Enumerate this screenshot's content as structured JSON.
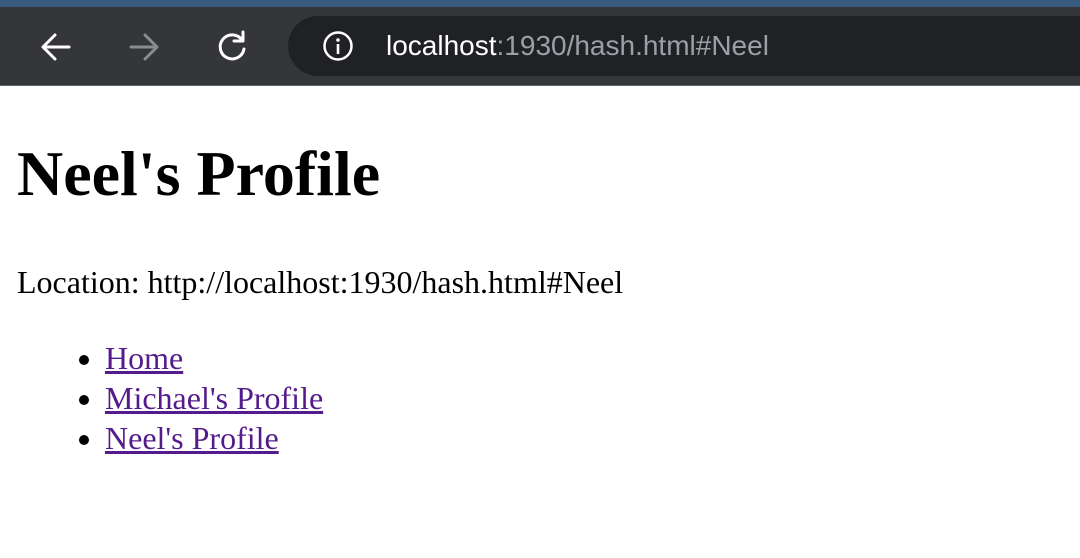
{
  "browser": {
    "url_host": "localhost",
    "url_rest": ":1930/hash.html#Neel",
    "chrome_color": "#35363a",
    "address_bar_color": "#202124"
  },
  "page": {
    "title": "Neel's Profile",
    "location_text": "Location: http://localhost:1930/hash.html#Neel",
    "links": [
      {
        "label": "Home"
      },
      {
        "label": "Michael's Profile"
      },
      {
        "label": "Neel's Profile"
      }
    ],
    "link_color": "#551a8b"
  }
}
